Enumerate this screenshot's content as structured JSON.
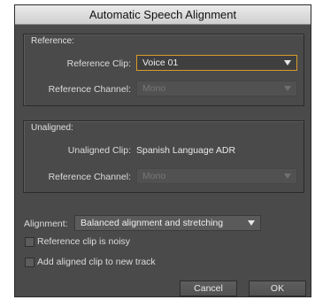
{
  "dialog": {
    "title": "Automatic Speech Alignment"
  },
  "reference": {
    "group_title": "Reference:",
    "clip_label": "Reference Clip:",
    "clip_value": "Voice 01",
    "channel_label": "Reference Channel:",
    "channel_value": "Mono"
  },
  "unaligned": {
    "group_title": "Unaligned:",
    "clip_label": "Unaligned Clip:",
    "clip_value": "Spanish Language ADR",
    "channel_label": "Reference Channel:",
    "channel_value": "Mono"
  },
  "alignment": {
    "label": "Alignment:",
    "value": "Balanced alignment and stretching"
  },
  "options": {
    "noisy_label": "Reference clip is noisy",
    "noisy_checked": false,
    "new_track_label": "Add aligned clip to new track",
    "new_track_checked": false
  },
  "buttons": {
    "cancel": "Cancel",
    "ok": "OK"
  },
  "colors": {
    "dialog_bg": "#4a4a4a",
    "active_border": "#d89b2a"
  }
}
